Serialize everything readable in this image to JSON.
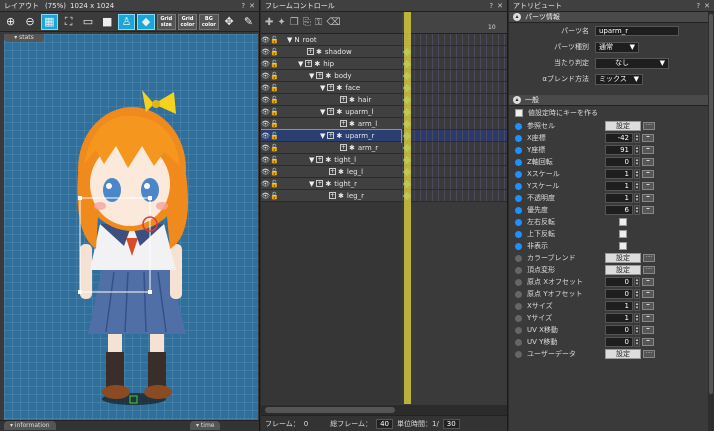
{
  "layout": {
    "title": "レイアウト",
    "zoom": "(75%)",
    "size": "1024 x 1024",
    "stats_tab": "▾ stats",
    "info_tab": "▾ information",
    "time_tab": "▾ time",
    "toolbar": [
      "zoom-in",
      "zoom-out",
      "grid",
      "fit",
      "screen",
      "bg",
      "bone",
      "pin",
      "move"
    ],
    "toolbar_text_buttons": [
      {
        "top": "Grid",
        "bottom": "size"
      },
      {
        "top": "Grid",
        "bottom": "color"
      },
      {
        "top": "BG",
        "bottom": "color"
      }
    ]
  },
  "frame": {
    "title": "フレームコントロール",
    "ruler_mark": "10",
    "parts": [
      {
        "name": "root",
        "indent": 0,
        "tri": "▼",
        "root": true
      },
      {
        "name": "shadow",
        "indent": 1,
        "tri": ""
      },
      {
        "name": "hip",
        "indent": 1,
        "tri": "▼"
      },
      {
        "name": "body",
        "indent": 2,
        "tri": "▼"
      },
      {
        "name": "face",
        "indent": 3,
        "tri": "▼"
      },
      {
        "name": "hair",
        "indent": 4,
        "tri": ""
      },
      {
        "name": "uparm_l",
        "indent": 3,
        "tri": "▼"
      },
      {
        "name": "arm_l",
        "indent": 4,
        "tri": ""
      },
      {
        "name": "uparm_r",
        "indent": 3,
        "tri": "▼",
        "selected": true
      },
      {
        "name": "arm_r",
        "indent": 4,
        "tri": ""
      },
      {
        "name": "tight_l",
        "indent": 2,
        "tri": "▼"
      },
      {
        "name": "leg_l",
        "indent": 3,
        "tri": ""
      },
      {
        "name": "tight_r",
        "indent": 2,
        "tri": "▼"
      },
      {
        "name": "leg_r",
        "indent": 3,
        "tri": ""
      }
    ],
    "bottom": {
      "frame_label": "フレーム：",
      "frame_value": "0",
      "total_label": "総フレーム：",
      "total_value": "40",
      "unit_label": "単位時間：1/",
      "unit_value": "30"
    }
  },
  "attr": {
    "title": "アトリビュート",
    "part_info_header": "パーツ情報",
    "part_name_label": "パーツ名",
    "part_name_value": "uparm_r",
    "part_type_label": "パーツ種別",
    "part_type_value": "通常",
    "hit_label": "当たり判定",
    "hit_value": "なし",
    "blend_label": "αブレンド方法",
    "blend_value": "ミックス",
    "general_header": "一般",
    "auto_key_label": "値設定時にキーを作る",
    "rows": [
      {
        "label": "参照セル",
        "kind": "btn",
        "value": "設定",
        "dot": "blue"
      },
      {
        "label": "X座標",
        "kind": "num",
        "value": "-42",
        "dot": "blue"
      },
      {
        "label": "Y座標",
        "kind": "num",
        "value": "91",
        "dot": "blue"
      },
      {
        "label": "Z軸回転",
        "kind": "num",
        "value": "0",
        "dot": "blue"
      },
      {
        "label": "Xスケール",
        "kind": "num",
        "value": "1",
        "dot": "blue"
      },
      {
        "label": "Yスケール",
        "kind": "num",
        "value": "1",
        "dot": "blue"
      },
      {
        "label": "不透明度",
        "kind": "num",
        "value": "1",
        "dot": "blue"
      },
      {
        "label": "優先度",
        "kind": "num",
        "value": "6",
        "dot": "blue"
      },
      {
        "label": "左右反転",
        "kind": "chk",
        "value": "",
        "dot": "blue"
      },
      {
        "label": "上下反転",
        "kind": "chk",
        "value": "",
        "dot": "blue"
      },
      {
        "label": "非表示",
        "kind": "chk",
        "value": "",
        "dot": "blue"
      },
      {
        "label": "カラーブレンド",
        "kind": "btn",
        "value": "設定",
        "dot": "grey"
      },
      {
        "label": "頂点変形",
        "kind": "btn",
        "value": "設定",
        "dot": "grey"
      },
      {
        "label": "原点 Xオフセット",
        "kind": "num",
        "value": "0",
        "dot": "grey"
      },
      {
        "label": "原点 Yオフセット",
        "kind": "num",
        "value": "0",
        "dot": "grey"
      },
      {
        "label": "Xサイズ",
        "kind": "num",
        "value": "1",
        "dot": "grey"
      },
      {
        "label": "Yサイズ",
        "kind": "num",
        "value": "1",
        "dot": "grey"
      },
      {
        "label": "UV X移動",
        "kind": "num",
        "value": "0",
        "dot": "grey"
      },
      {
        "label": "UV Y移動",
        "kind": "num",
        "value": "0",
        "dot": "grey"
      },
      {
        "label": "ユーザーデータ",
        "kind": "btn",
        "value": "設定",
        "dot": "grey"
      }
    ]
  },
  "colors": {
    "accent": "#1aa7d8",
    "canvas": "#2f6f9c",
    "keyframe": "#46c6e4",
    "selection": "#2b3e72"
  }
}
